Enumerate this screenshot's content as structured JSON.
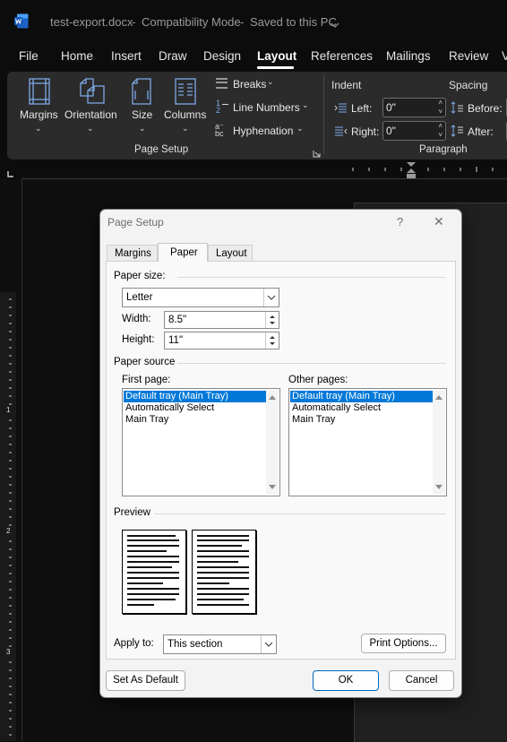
{
  "titlebar": {
    "app_icon": "word-icon",
    "filename": "test-export.docx",
    "sep1": "-",
    "mode": "Compatibility Mode",
    "sep2": "-",
    "save_status": "Saved to this PC",
    "status_chevron": "chevron-down-icon"
  },
  "tabs": [
    {
      "label": "File"
    },
    {
      "label": "Home"
    },
    {
      "label": "Insert"
    },
    {
      "label": "Draw"
    },
    {
      "label": "Design"
    },
    {
      "label": "Layout"
    },
    {
      "label": "References"
    },
    {
      "label": "Mailings"
    },
    {
      "label": "Review"
    },
    {
      "label": "V"
    }
  ],
  "active_tab": "Layout",
  "ribbon": {
    "page_setup": {
      "group_label": "Page Setup",
      "margins": "Margins",
      "orientation": "Orientation",
      "size": "Size",
      "columns": "Columns",
      "breaks": "Breaks",
      "line_numbers": "Line Numbers",
      "hyphenation": "Hyphenation"
    },
    "paragraph": {
      "group_label": "Paragraph",
      "indent_label": "Indent",
      "spacing_label": "Spacing",
      "left_label": "Left:",
      "left_value": "0\"",
      "right_label": "Right:",
      "right_value": "0\"",
      "before_label": "Before:",
      "after_label": "After:"
    }
  },
  "ruler": {
    "vertical_numbers": [
      "1",
      "2",
      "3"
    ]
  },
  "dialog": {
    "title": "Page Setup",
    "help": "?",
    "close": "✕",
    "tabs": [
      {
        "label": "Margins"
      },
      {
        "label": "Paper"
      },
      {
        "label": "Layout"
      }
    ],
    "active_tab": "Paper",
    "paper_size": {
      "section_label": "Paper size:",
      "selected": "Letter",
      "width_label": "Width:",
      "width_value": "8.5\"",
      "height_label": "Height:",
      "height_value": "11\""
    },
    "paper_source": {
      "section_label": "Paper source",
      "first_page_label": "First page:",
      "first_page_items": [
        "Default tray (Main Tray)",
        "Automatically Select",
        "Main Tray"
      ],
      "first_page_selected": "Default tray (Main Tray)",
      "other_pages_label": "Other pages:",
      "other_pages_items": [
        "Default tray (Main Tray)",
        "Automatically Select",
        "Main Tray"
      ],
      "other_pages_selected": "Default tray (Main Tray)"
    },
    "preview": {
      "section_label": "Preview"
    },
    "apply_to": {
      "label": "Apply to:",
      "selected": "This section"
    },
    "buttons": {
      "print_options": "Print Options...",
      "set_as_default": "Set As Default",
      "ok": "OK",
      "cancel": "Cancel"
    }
  },
  "colors": {
    "accent": "#0078d7",
    "ribbon_bg": "#2b2b2b",
    "icon_blue": "#7ea9e8"
  }
}
